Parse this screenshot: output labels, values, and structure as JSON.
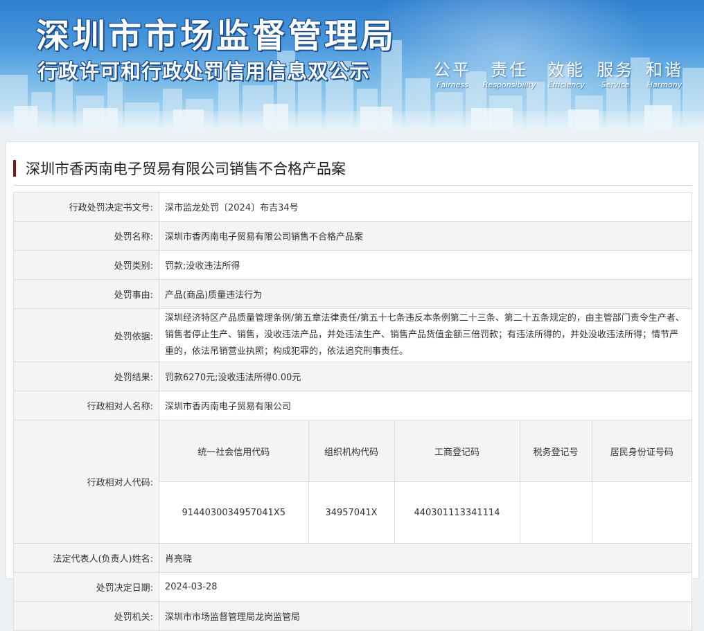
{
  "banner": {
    "title": "深圳市市场监督管理局",
    "subtitle": "行政许可和行政处罚信用信息双公示",
    "slogans": [
      {
        "zh": "公平",
        "en": "Fairness"
      },
      {
        "zh": "责任",
        "en": "Responsibility"
      },
      {
        "zh": "效能",
        "en": "Efficiency"
      },
      {
        "zh": "服务",
        "en": "Service"
      },
      {
        "zh": "和谐",
        "en": "Harmony"
      }
    ]
  },
  "case": {
    "title": "深圳市香丙南电子贸易有限公司销售不合格产品案"
  },
  "fields": {
    "doc_no": {
      "label": "行政处罚决定书文号:",
      "value": "深市监龙处罚〔2024〕布吉34号"
    },
    "name": {
      "label": "处罚名称:",
      "value": "深圳市香丙南电子贸易有限公司销售不合格产品案"
    },
    "category": {
      "label": "处罚类别:",
      "value": "罚款;没收违法所得"
    },
    "reason": {
      "label": "处罚事由:",
      "value": "产品(商品)质量违法行为"
    },
    "basis": {
      "label": "处罚依据:",
      "value": "深圳经济特区产品质量管理条例/第五章法律责任/第五十七条违反本条例第二十三条、第二十五条规定的，由主管部门责令生产者、销售者停止生产、销售，没收违法产品，并处违法生产、销售产品货值金额三倍罚款；有违法所得的，并处没收违法所得；情节严重的，依法吊销营业执照；构成犯罪的，依法追究刑事责任。"
    },
    "result": {
      "label": "处罚结果:",
      "value": "罚款6270元;没收违法所得0.00元"
    },
    "party_name": {
      "label": "行政相对人名称:",
      "value": "深圳市香丙南电子贸易有限公司"
    },
    "party_code": {
      "label": "行政相对人代码:",
      "headers": [
        "统一社会信用代码",
        "组织机构代码",
        "工商登记码",
        "税务登记号",
        "居民身份证号码"
      ],
      "values": [
        "9144030034957041X5",
        "34957041X",
        "440301113341114",
        "",
        ""
      ]
    },
    "legal_rep": {
      "label": "法定代表人(负责人)姓名:",
      "value": "肖亮晓"
    },
    "decision_date": {
      "label": "处罚决定日期:",
      "value": "2024-03-28"
    },
    "authority": {
      "label": "处罚机关:",
      "value": "深圳市市场监督管理局龙岗监管局"
    }
  },
  "colors": {
    "accent_bar": "#7a1a1a",
    "banner_top": "#2f7fd0",
    "label_bg": "#f4f4f4"
  }
}
